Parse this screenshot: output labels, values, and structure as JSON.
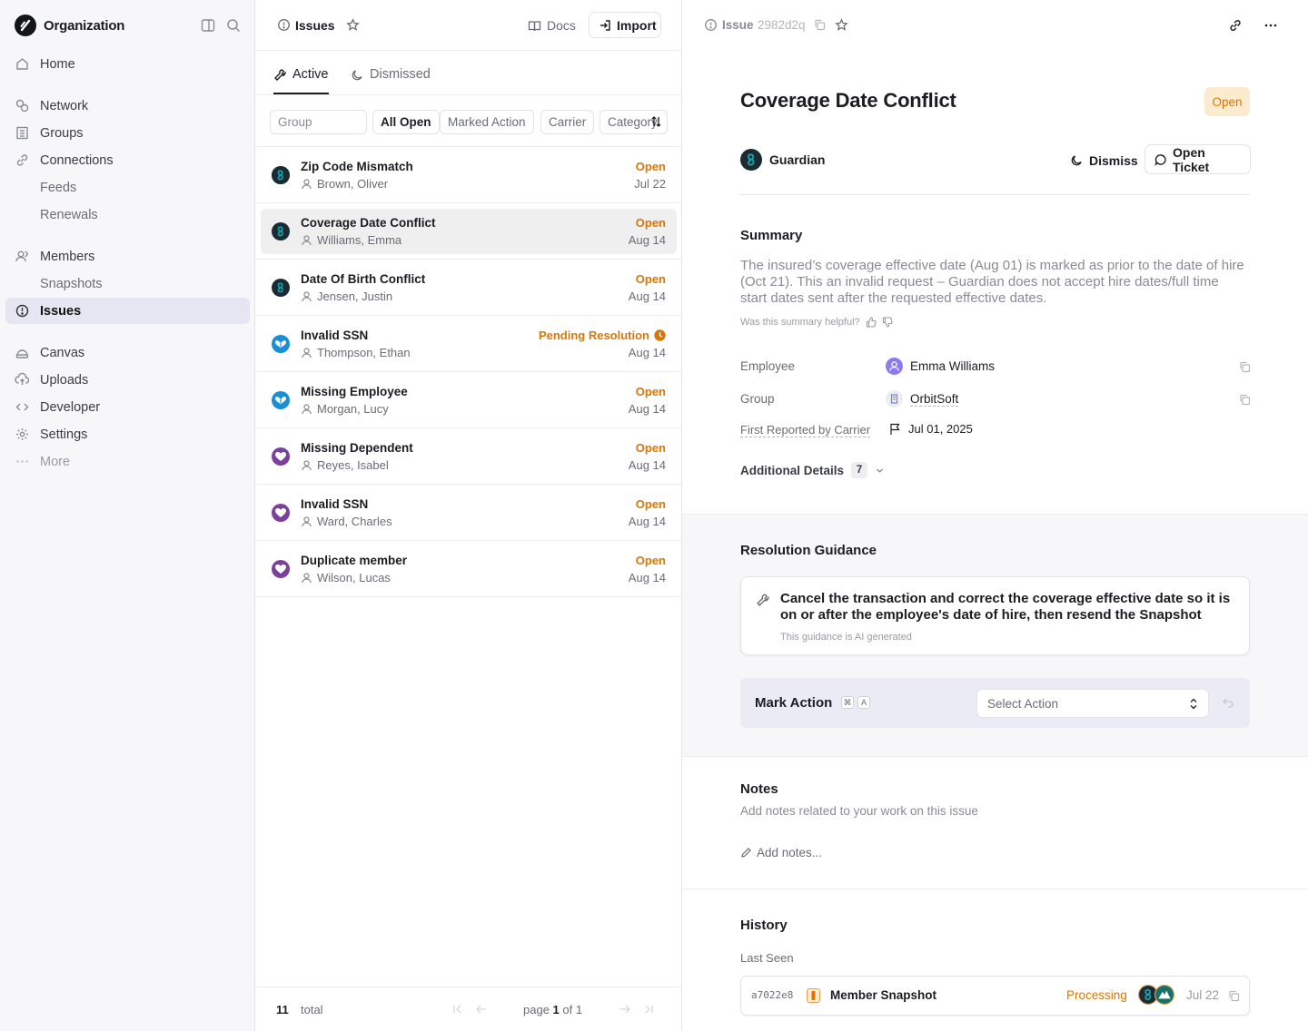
{
  "sidebar": {
    "org_name": "Organization",
    "nav": [
      {
        "label": "Home",
        "icon": "home-icon"
      },
      {
        "label": "Network",
        "icon": "network-icon"
      },
      {
        "label": "Groups",
        "icon": "building-icon"
      },
      {
        "label": "Connections",
        "icon": "link-icon"
      },
      {
        "label": "Feeds"
      },
      {
        "label": "Renewals"
      },
      {
        "label": "Members",
        "icon": "users-icon"
      },
      {
        "label": "Snapshots"
      },
      {
        "label": "Issues",
        "icon": "alert-circle-icon",
        "active": true
      },
      {
        "label": "Canvas",
        "icon": "canvas-icon"
      },
      {
        "label": "Uploads",
        "icon": "upload-icon"
      },
      {
        "label": "Developer",
        "icon": "code-icon"
      },
      {
        "label": "Settings",
        "icon": "gear-icon"
      },
      {
        "label": "More",
        "icon": "dots-icon"
      }
    ]
  },
  "list": {
    "header_title": "Issues",
    "docs_label": "Docs",
    "import_label": "Import",
    "tabs": [
      "Active",
      "Dismissed"
    ],
    "filters": {
      "group_placeholder": "Group",
      "chips": [
        "All Open",
        "Marked Action",
        "Carrier",
        "Category"
      ]
    },
    "rows": [
      {
        "title": "Zip Code Mismatch",
        "person": "Brown, Oliver",
        "status": "Open",
        "date": "Jul 22",
        "carrier": "guardian"
      },
      {
        "title": "Coverage Date Conflict",
        "person": "Williams, Emma",
        "status": "Open",
        "date": "Aug 14",
        "carrier": "guardian",
        "selected": true
      },
      {
        "title": "Date Of Birth Conflict",
        "person": "Jensen, Justin",
        "status": "Open",
        "date": "Aug 14",
        "carrier": "guardian"
      },
      {
        "title": "Invalid SSN",
        "person": "Thompson, Ethan",
        "status": "Pending Resolution",
        "date": "Aug 14",
        "carrier": "blue"
      },
      {
        "title": "Missing Employee",
        "person": "Morgan, Lucy",
        "status": "Open",
        "date": "Aug 14",
        "carrier": "blue"
      },
      {
        "title": "Missing Dependent",
        "person": "Reyes, Isabel",
        "status": "Open",
        "date": "Aug 14",
        "carrier": "purple"
      },
      {
        "title": "Invalid SSN",
        "person": "Ward, Charles",
        "status": "Open",
        "date": "Aug 14",
        "carrier": "purple"
      },
      {
        "title": "Duplicate member",
        "person": "Wilson, Lucas",
        "status": "Open",
        "date": "Aug 14",
        "carrier": "purple"
      }
    ],
    "footer": {
      "total_count": "11",
      "total_label": "total",
      "page_word": "page",
      "page_current": "1",
      "page_of": "of 1"
    }
  },
  "detail": {
    "header_label": "Issue",
    "issue_id": "2982d2q",
    "title": "Coverage Date Conflict",
    "status": "Open",
    "carrier_name": "Guardian",
    "dismiss_label": "Dismiss",
    "open_ticket_label": "Open Ticket",
    "summary_title": "Summary",
    "summary_text": "The insured’s coverage effective date (Aug 01) is marked as prior to the date of hire (Oct 21). This an invalid request – Guardian does not accept hire dates/full time start dates sent after the requested effective dates.",
    "summary_feedback": "Was this summary helpful?",
    "employee_label": "Employee",
    "employee_value": "Emma Williams",
    "group_label": "Group",
    "group_value": "OrbitSoft",
    "reported_label": "First Reported by Carrier",
    "reported_value": "Jul 01, 2025",
    "additional_label": "Additional Details",
    "additional_count": "7",
    "resolution_title": "Resolution Guidance",
    "guidance_text": "Cancel the transaction and correct the coverage effective date so it is on or after the employee's date of hire, then resend the Snapshot",
    "guidance_note": "This guidance is AI generated",
    "mark_action_label": "Mark Action",
    "shortcut_keys": [
      "⌘",
      "A"
    ],
    "select_action_placeholder": "Select Action",
    "notes_title": "Notes",
    "notes_subtitle": "Add notes related to your work on this issue",
    "add_notes_label": "Add notes...",
    "history_title": "History",
    "last_seen_label": "Last Seen",
    "history_item": {
      "hash": "a7022e8",
      "label": "Member Snapshot",
      "status": "Processing",
      "date": "Jul 22"
    }
  },
  "colors": {
    "accent_orange": "#d97706",
    "open_badge_bg": "#fdebd0",
    "guardian_teal": "#1ba0a8",
    "blue_carrier": "#1a8fd6",
    "purple_carrier": "#7b3f9e",
    "active_nav_bg": "#e6e6f2"
  }
}
